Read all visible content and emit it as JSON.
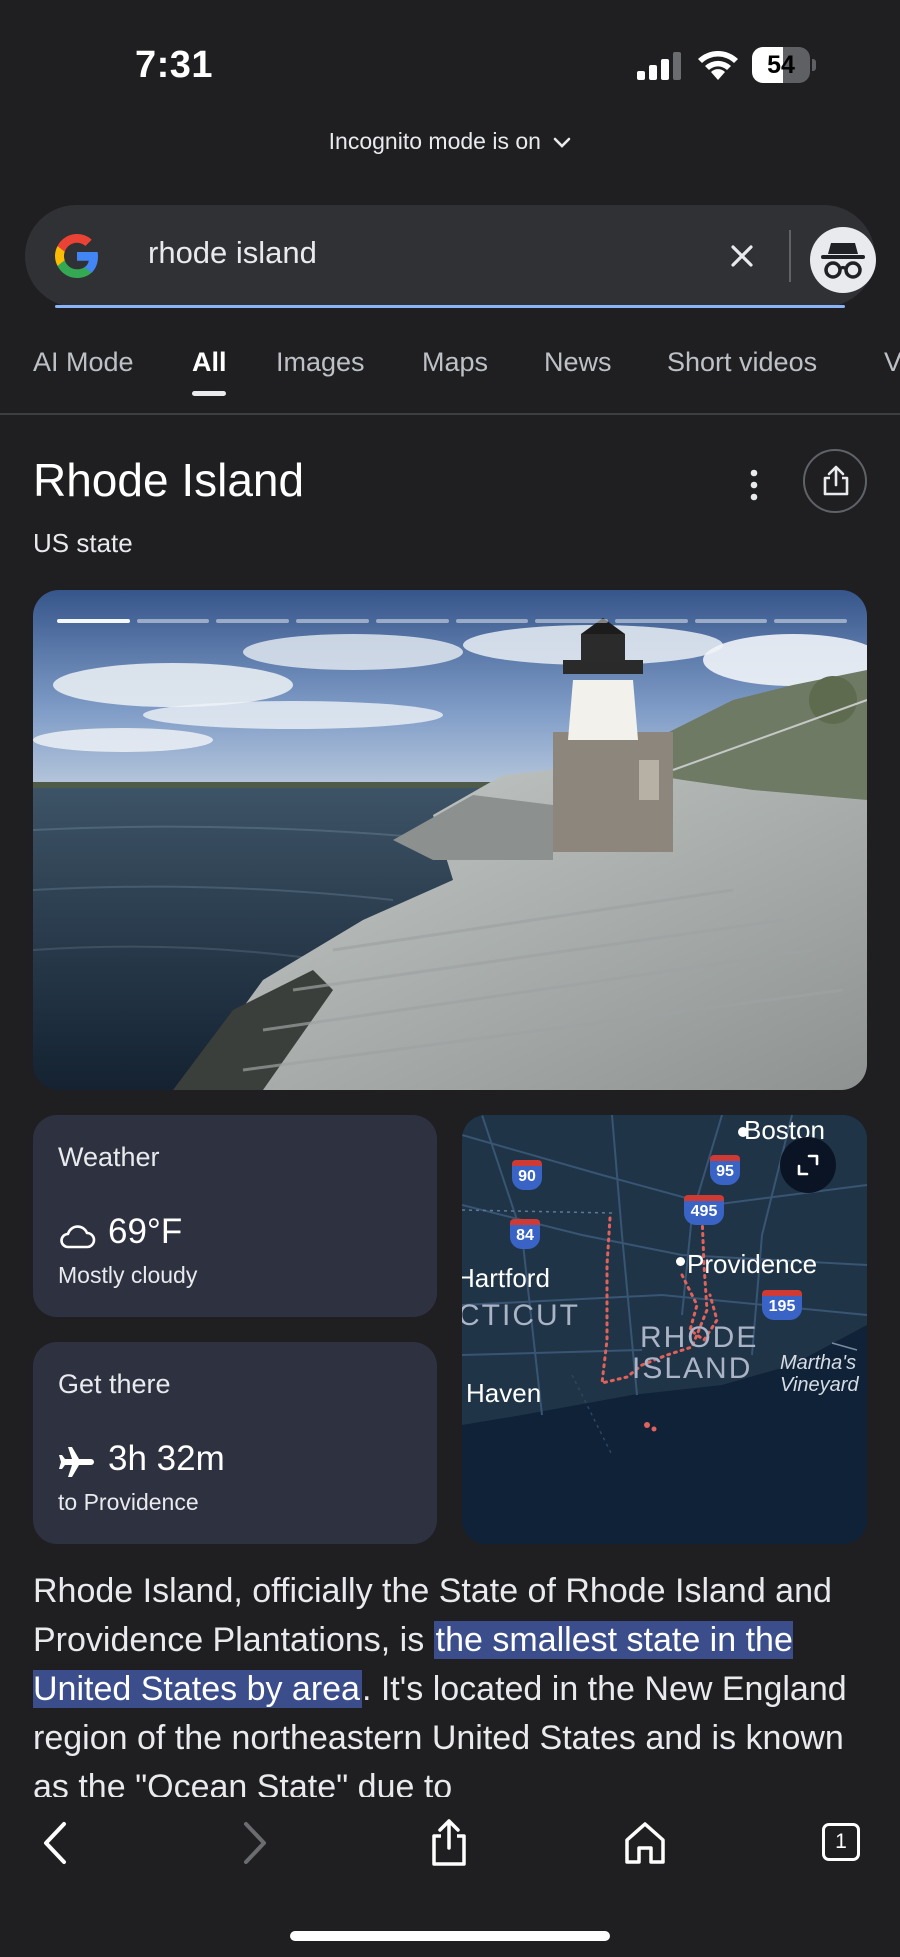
{
  "status_bar": {
    "time": "7:31",
    "battery": 54,
    "battery_text": "54"
  },
  "incognito_label": "Incognito mode is on",
  "search": {
    "query": "rhode island"
  },
  "tabs": [
    "AI Mode",
    "All",
    "Images",
    "Maps",
    "News",
    "Short videos",
    "V"
  ],
  "active_tab": "All",
  "entity": {
    "title": "Rhode Island",
    "subtitle": "US state"
  },
  "hero_gallery": {
    "segments": 10,
    "current": 1
  },
  "weather": {
    "title": "Weather",
    "temp": "69°F",
    "condition": "Mostly cloudy",
    "icon": "cloud-icon"
  },
  "travel": {
    "title": "Get there",
    "duration": "3h 32m",
    "destination": "to Providence",
    "icon": "plane-icon"
  },
  "map": {
    "labels": {
      "boston": "Boston",
      "providence": "Providence",
      "hartford": "Hartford",
      "connecticut": "CTICUT",
      "rhode": "RHODE",
      "island": "ISLAND",
      "haven": "Haven",
      "marthas": "Martha's",
      "vineyard": "Vineyard"
    },
    "shields": {
      "i90": "90",
      "i95": "95",
      "i495": "495",
      "i84": "84",
      "i195": "195"
    }
  },
  "description": {
    "before": "Rhode Island, officially the State of Rhode Island and Providence Plantations, is ",
    "highlight": "the smallest state in the United States by area",
    "after": ". It's located in the New England region of the northeastern United States and is known as the \"Ocean State\" due to"
  },
  "toolbar": {
    "tab_count": "1"
  }
}
